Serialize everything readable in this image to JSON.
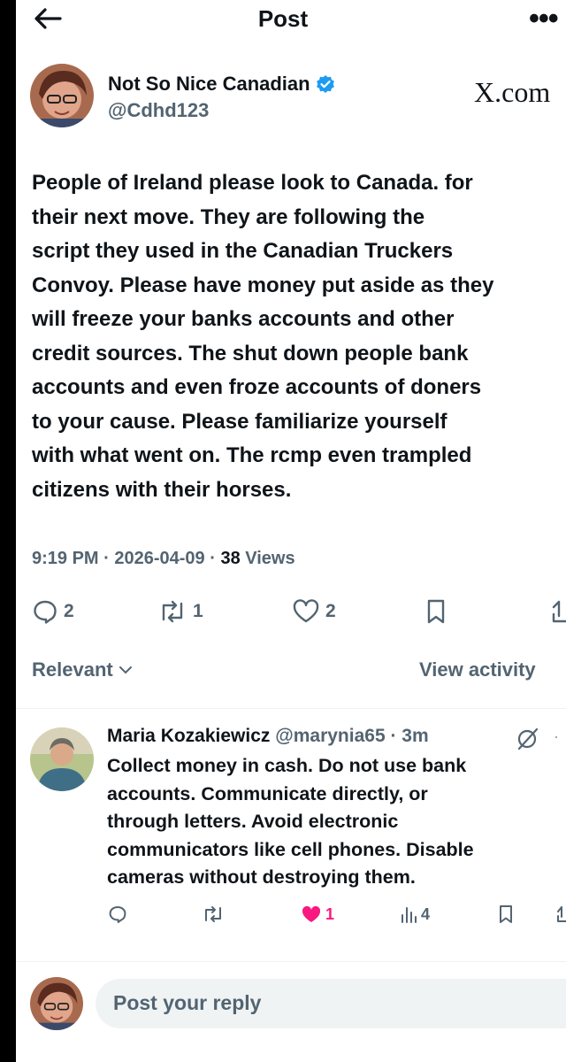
{
  "header": {
    "title": "Post"
  },
  "author": {
    "name": "Not So Nice Canadian",
    "handle": "@Cdhd123",
    "watermark": "X.com"
  },
  "post": {
    "text": "People of Ireland please look to Canada. for\ntheir next move. They are following the\nscript they used in the Canadian Truckers\nConvoy. Please have money put aside as they\nwill freeze your banks accounts and other\ncredit sources. The shut down people bank\naccounts and even froze accounts of doners\nto your cause. Please familiarize yourself\nwith what went on. The rcmp even trampled\ncitizens with their horses.",
    "time": "9:19 PM",
    "date": "2026-04-09",
    "separator": " · ",
    "views_count": "38",
    "views_label": " Views",
    "replies": "2",
    "reposts": "1",
    "likes": "2"
  },
  "sort": {
    "label": "Relevant",
    "view_activity": "View activity"
  },
  "reply": {
    "name": "Maria Kozakiewicz",
    "handle": "@marynia65",
    "time": "· 3m",
    "text": "Collect money in cash. Do not use bank\naccounts. Communicate directly,  or\nthrough letters. Avoid electronic\ncommunicators like cell phones. Disable\ncameras without destroying them.",
    "likes": "1",
    "views": "4"
  },
  "composer": {
    "placeholder": "Post your reply"
  },
  "colors": {
    "accent": "#1d9bf0",
    "like": "#f91880",
    "muted": "#536471",
    "text": "#0f1419"
  }
}
